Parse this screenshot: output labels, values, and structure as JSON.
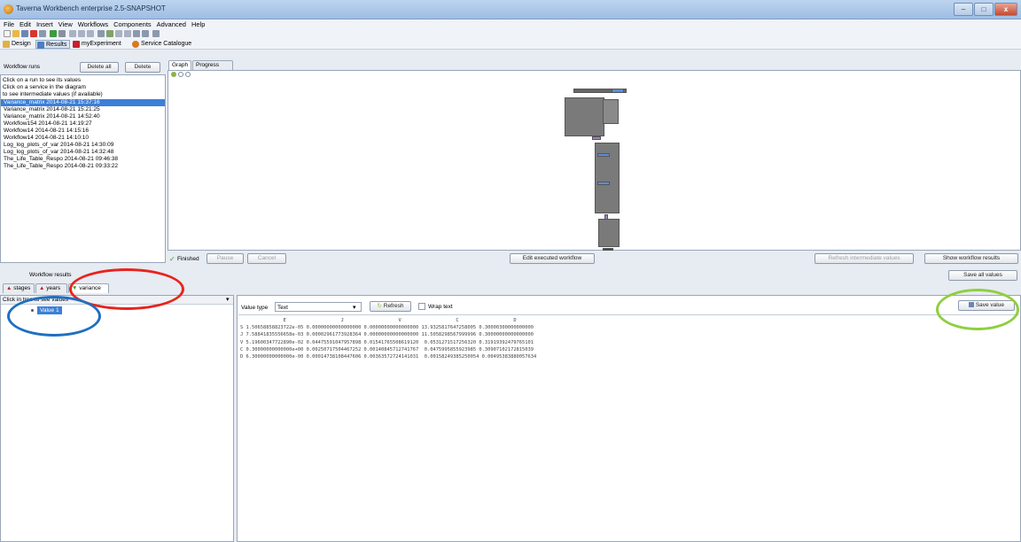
{
  "window": {
    "title": "Taverna Workbench enterprise 2.5-SNAPSHOT"
  },
  "menu": [
    "File",
    "Edit",
    "Insert",
    "View",
    "Workflows",
    "Components",
    "Advanced",
    "Help"
  ],
  "perspectives": [
    "Design",
    "Results",
    "myExperiment",
    "Service Catalogue"
  ],
  "runs": {
    "header": "Workflow runs",
    "delete_all": "Delete all",
    "delete": "Delete",
    "help": [
      "Click on a run to see its values",
      "Click on a service in the diagram",
      "to see intermediate values (if available)"
    ],
    "items": [
      "Variance_matrix 2014-08-21 15:37:16",
      "Variance_matrix 2014-08-21 15:21:25",
      "Variance_matrix 2014-08-21 14:52:40",
      "Workflow154 2014-08-21 14:19:27",
      "Workflow14 2014-08-21 14:15:16",
      "Workflow14 2014-08-21 14:10:10",
      "Log_log_plots_of_var 2014-08-21 14:30:09",
      "Log_log_plots_of_var 2014-08-21 14:32:48",
      "The_Life_Table_Respo 2014-08-21 09:46:38",
      "The_Life_Table_Respo 2014-08-21 09:33:22"
    ]
  },
  "graph_tabs": [
    "Graph",
    "Progress report"
  ],
  "status": {
    "finished": "Finished",
    "pause": "Pause",
    "cancel": "Cancel",
    "edit_workflow": "Edit executed workflow",
    "refresh_intermediate": "Refresh intermediate values",
    "show_results": "Show workflow results"
  },
  "results": {
    "header": "Workflow results",
    "save_all": "Save all values",
    "tabs": [
      "stages",
      "years",
      "variance"
    ],
    "tree_hint": "Click in tree to see values",
    "tree_item": "Value 1",
    "value_type_label": "Value type",
    "value_type": "Text",
    "refresh": "Refresh",
    "wrap_text": "Wrap text",
    "save_value": "Save value",
    "table_text": "               E                   J                   V                   C                   D\nS 1.50658858823722e-05 0.00000000000000000 0.00000000000000000 13.9325817647258005 0.30000300000000000\nJ 7.58841835556658e-03 0.00002961773928364 0.00000000000000000 11.5058298567999996 0.30000000000000000\nV 5.19600347722890e-02 0.04475591047957898 0.01541765508619120  0.0531271517256320 0.31919392479765101\nC 0.30000000000000e+00 0.00250717504467252 0.00140845712741767  0.0475995855923985 0.30907102172815039\nD 6.30000000000000e-00 0.00014738108447606 0.00363572724141031  0.00158249385250054 0.00495383880057634"
  },
  "colors": {
    "red_circle": "#e8231e",
    "blue_circle": "#1f6fc1",
    "green_circle": "#8fcf3f"
  }
}
